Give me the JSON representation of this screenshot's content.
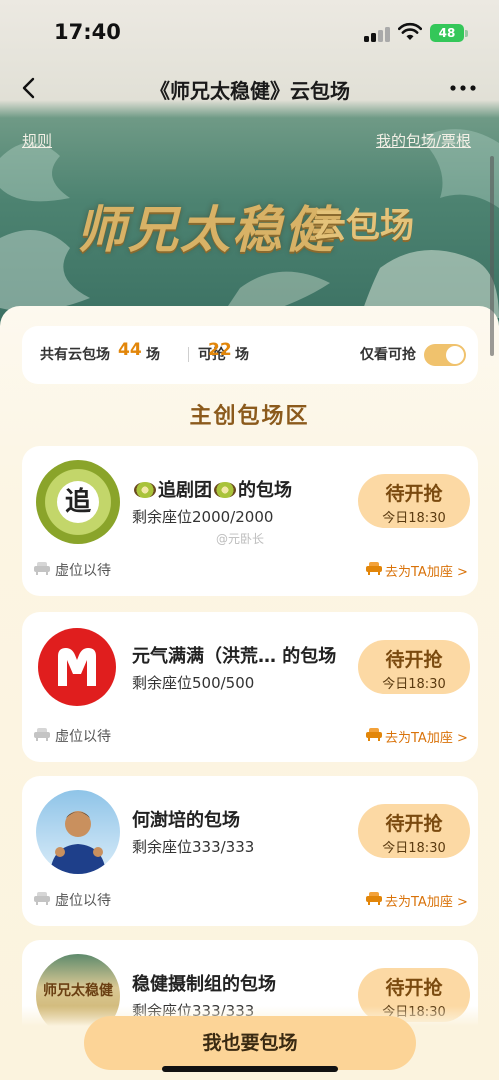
{
  "status": {
    "time": "17:40",
    "battery": "48"
  },
  "nav": {
    "title": "《师兄太稳健》云包场"
  },
  "banner": {
    "rules": "规则",
    "my_link": "我的包场/票根",
    "title_main": "师兄太稳健",
    "title_sub": "云包场"
  },
  "summary": {
    "total_label": "共有云包场",
    "total": "44",
    "total_unit": "场",
    "available_label": "可抢",
    "available": "22",
    "available_unit": "场",
    "only_available_label": "仅看可抢",
    "only_available_on": true
  },
  "section_title": "主创包场区",
  "cards": [
    {
      "title_prefix": "",
      "title_name": "追剧团",
      "title_suffix": "的包场",
      "seats": "剩余座位2000/2000",
      "button": "待开抢",
      "time": "今日18:30",
      "vacant": "虚位以待",
      "add": "去为TA加座 >",
      "avatar_text": "追"
    },
    {
      "title": "元气满满（洪荒… 的包场",
      "seats": "剩余座位500/500",
      "button": "待开抢",
      "time": "今日18:30",
      "vacant": "虚位以待",
      "add": "去为TA加座 >"
    },
    {
      "title": "何澍培的包场",
      "seats": "剩余座位333/333",
      "button": "待开抢",
      "time": "今日18:30",
      "vacant": "虚位以待",
      "add": "去为TA加座 >"
    },
    {
      "title": "稳健摄制组的包场",
      "seats": "剩余座位333/333",
      "button": "待开抢",
      "time": "今日18:30",
      "avatar_text": "师兄太稳健"
    }
  ],
  "watermark": "@元卧长",
  "bottom_button": "我也要包场",
  "colors": {
    "accent": "#e2860a",
    "button": "#fcd497",
    "banner_green": "#4d8371"
  }
}
